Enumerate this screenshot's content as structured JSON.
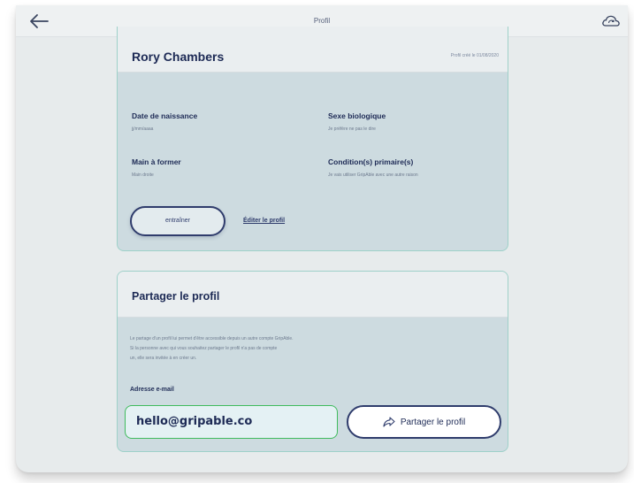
{
  "header": {
    "title": "Profil"
  },
  "profile": {
    "name": "Rory Chambers",
    "last_seen": "Profil créé le 01/08/2020",
    "fields": [
      {
        "label": "Date de naissance",
        "value": "jj/mm/aaaa"
      },
      {
        "label": "Sexe biologique",
        "value": "Je préfère ne pas le dire"
      },
      {
        "label": "Main à former",
        "value": "Main droite"
      },
      {
        "label": "Condition(s) primaire(s)",
        "value": "Je vais utiliser GripAble avec une autre raison"
      }
    ],
    "train_label": "entraîner",
    "edit_label": "Éditer le profil"
  },
  "share": {
    "title": "Partager le profil",
    "description": [
      "Le partage d'un profil lui permet d'être accessible depuis un autre compte GripAble.",
      "Si la personne avec qui vous souhaitez partager le profil n'a pas de compte",
      "un, elle sera invitée à en créer un."
    ],
    "email_label": "Adresse e-mail",
    "email_value": "hello@gripable.co",
    "button_label": "Partager le profil"
  },
  "icons": {
    "back": "arrow-left-icon",
    "cloud": "cloud-sync-icon",
    "share": "share-arrow-icon"
  },
  "colors": {
    "navy": "#1d2a55",
    "teal_border": "#9ed1c9",
    "green_focus": "#3fbb5d",
    "card_bg": "#cddbe0"
  }
}
